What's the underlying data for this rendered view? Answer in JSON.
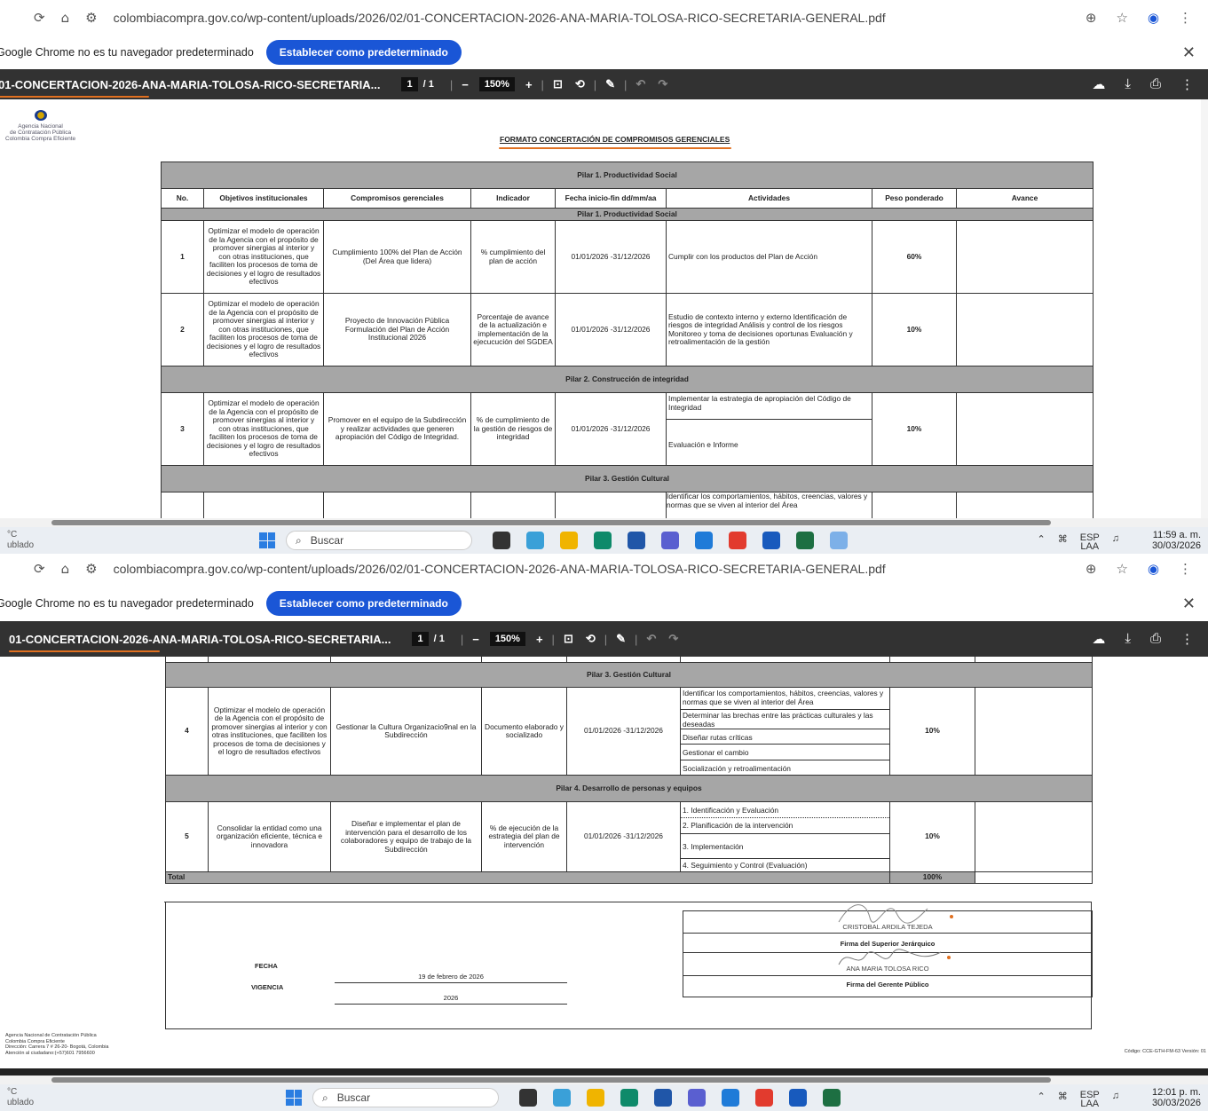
{
  "browser": {
    "url": "colombiacompra.gov.co/wp-content/uploads/2026/02/01-CONCERTACION-2026-ANA-MARIA-TOLOSA-RICO-SECRETARIA-GENERAL.pdf",
    "infobar_text": "Google Chrome no es tu navegador predeterminado",
    "infobar_button": "Establecer como predeterminado"
  },
  "pdf_toolbar": {
    "title": "01-CONCERTACION-2026-ANA-MARIA-TOLOSA-RICO-SECRETARIA...",
    "page_current": "1",
    "page_total": "/ 1",
    "zoom": "150%"
  },
  "document": {
    "title": "FORMATO CONCERTACIÓN DE COMPROMISOS GERENCIALES",
    "logo_lines": [
      "Agencia Nacional",
      "de Contratación Pública",
      "Colombia Compra Eficiente"
    ],
    "headers": [
      "No.",
      "Objetivos institucionales",
      "Compromisos gerenciales",
      "Indicador",
      "Fecha inicio-fin dd/mm/aa",
      "Actividades",
      "Peso ponderado",
      "Avance"
    ],
    "pilar1": "Pilar 1. Productividad Social",
    "pilar2": "Pilar 2. Construcción de integridad",
    "pilar3": "Pilar 3. Gestión Cultural",
    "pilar4": "Pilar 4. Desarrollo de personas y equipos",
    "objetivo_std": "Optimizar el modelo de operación  de la Agencia con el propósito de promover sinergias al interior y con otras instituciones, que faciliten los procesos de toma de decisiones y el logro de resultados efectivos",
    "objetivo_cut": "Optimizar el modelo de",
    "fecha": "01/01/2026 -31/12/2026",
    "rows": [
      {
        "no": "1",
        "compromiso": "Cumplimiento 100% del Plan de Acción  (Del Área que lidera)",
        "indicador": "% cumplimiento del plan de acción",
        "actividades": [
          "Cumplir con los productos del Plan de Acción"
        ],
        "peso": "60%"
      },
      {
        "no": "2",
        "compromiso": "Proyecto de Innovación Pública Formulación del Plan de Acción Institucional 2026",
        "indicador": "Porcentaje de avance de la actualización e implementación de la ejecucución del SGDEA",
        "actividades": [
          "Estudio de contexto interno y externo Identificación de riesgos de integridad Análisis y control de los riesgos Monitoreo y toma de decisiones oportunas Evaluación y retroalimentación de la gestión"
        ],
        "peso": "10%"
      },
      {
        "no": "3",
        "compromiso": "Promover en el equipo de la Subdirección  y realizar actividades que generen apropiación del Código de Integridad.",
        "indicador": "% de cumplimiento de la gestión de riesgos de integridad",
        "actividades": [
          "Implementar la estrategia de apropiación del Código de Integridad",
          "Evaluación e Informe"
        ],
        "peso": "10%"
      },
      {
        "no": "4",
        "compromiso": "Gestionar la Cultura Organizacio9nal en la Subdirección",
        "indicador": "Documento elaborado y socializado",
        "actividades": [
          "Identificar los comportamientos, hábitos, creencias, valores y normas que se viven al interior del Área",
          "Determinar las brechas entre las prácticas culturales y las deseadas",
          "Diseñar rutas críticas",
          "Gestionar el cambio",
          "Socialización y retroalimentación"
        ],
        "peso": "10%"
      },
      {
        "no": "5",
        "objetivo": "Consolidar la entidad como una organización eficiente, técnica e innovadora",
        "compromiso": "Diseñar e implementar el plan de intervención para el desarrollo de los colaboradores y equipo de trabajo de la Subdirección",
        "indicador": "% de ejecución de la estrategia del plan de intervención",
        "actividades": [
          "1. Identificación y Evaluación",
          "2. Planificación de la intervención",
          "3. Implementación",
          "4. Seguimiento y Control (Evaluación)"
        ],
        "peso": "10%"
      }
    ],
    "actividad_cut": "Identificar los comportamientos, hábitos, creencias, valores y normas que se viven al interior del Área",
    "total_label": "Total",
    "total_value": "100%",
    "fecha_label": "FECHA",
    "fecha_value": "19 de febrero de 2026",
    "vigencia_label": "VIGENCIA",
    "vigencia_value": "2026",
    "superior_name": "CRISTOBAL ARDILA TEJEDA",
    "superior_role": "Firma del Superior Jerárquico",
    "gerente_name": "ANA MARIA TOLOSA RICO",
    "gerente_role": "Firma del Gerente Público",
    "footer_lines": [
      "Agencia Nacional de Contratación Pública",
      "Colombia Compra Eficiente",
      "Dirección: Carrera 7 # 26-20- Bogotá, Colombia",
      "Atención al ciudadano:(+57)601 7956600"
    ],
    "footer_code": "Código: CCE-GTH-FM-63 Versión: 01"
  },
  "taskbar1": {
    "search": "Buscar",
    "time": "11:59 a. m.",
    "date": "30/03/2026",
    "lang": "ESP",
    "lang2": "LAA",
    "weather": "°C",
    "weather2": "ublado"
  },
  "taskbar2": {
    "search": "Buscar",
    "time": "12:01 p. m.",
    "date": "30/03/2026",
    "lang": "ESP",
    "lang2": "LAA",
    "weather": "°C",
    "weather2": "ublado"
  },
  "colors": {
    "pilar_bg": "#a6a6a6",
    "toolbar": "#323232",
    "accent": "#1a56d6",
    "underline": "#e07020"
  }
}
